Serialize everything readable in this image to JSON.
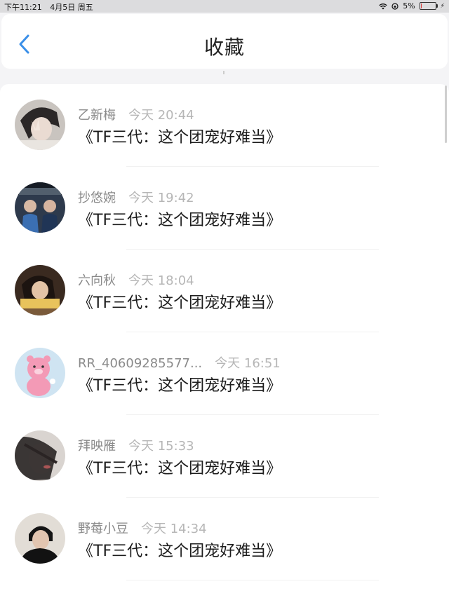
{
  "status_bar": {
    "time": "下午11:21",
    "date": "4月5日 周五",
    "battery": "5%"
  },
  "header": {
    "title": "收藏"
  },
  "items": [
    {
      "name": "乙新梅",
      "time": "今天 20:44",
      "title": "《TF三代：这个团宠好难当》"
    },
    {
      "name": "抄悠婉",
      "time": "今天 19:42",
      "title": "《TF三代：这个团宠好难当》"
    },
    {
      "name": "六向秋",
      "time": "今天 18:04",
      "title": "《TF三代：这个团宠好难当》"
    },
    {
      "name": "RR_40609285577...",
      "time": "今天 16:51",
      "title": "《TF三代：这个团宠好难当》"
    },
    {
      "name": "拜映雁",
      "time": "今天 15:33",
      "title": "《TF三代：这个团宠好难当》"
    },
    {
      "name": "野莓小豆",
      "time": "今天 14:34",
      "title": "《TF三代：这个团宠好难当》"
    }
  ],
  "colors": {
    "accent": "#3a8fe8"
  }
}
